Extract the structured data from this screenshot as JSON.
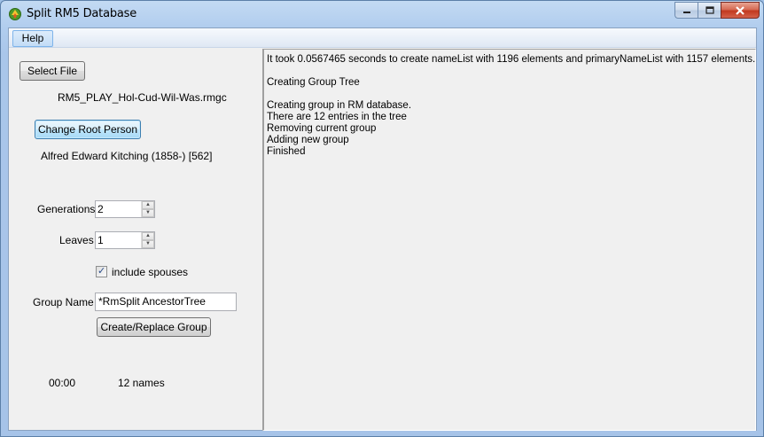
{
  "window": {
    "title": "Split RM5 Database",
    "controls": {
      "minimize": "minimize-icon",
      "maximize": "maximize-icon",
      "close": "close-icon"
    }
  },
  "menu": {
    "help": "Help"
  },
  "left": {
    "select_file_label": "Select File",
    "file_name": "RM5_PLAY_Hol-Cud-Wil-Was.rmgc",
    "change_root_label": "Change Root Person",
    "root_person": "Alfred Edward Kitching (1858-) [562]",
    "generations_label": "Generations",
    "generations_value": "2",
    "leaves_label": "Leaves",
    "leaves_value": "1",
    "include_spouses_label": "include spouses",
    "include_spouses_checked": true,
    "group_name_label": "Group Name",
    "group_name_value": "*RmSplit AncestorTree",
    "create_replace_label": "Create/Replace Group",
    "elapsed": "00:00",
    "name_count": "12 names"
  },
  "log": {
    "lines": [
      "It took 0.0567465 seconds to create nameList with 1196 elements and primaryNameList with 1157 elements.",
      "",
      "Creating Group Tree",
      "",
      "Creating group in RM database.",
      "There are 12 entries in the tree",
      "Removing current group",
      "Adding new group",
      "Finished"
    ]
  },
  "colors": {
    "title_bar": "#b1cdee",
    "client_bg": "#f0f0f0",
    "close_button": "#c2391f",
    "focus_border": "#3c7fb1"
  }
}
